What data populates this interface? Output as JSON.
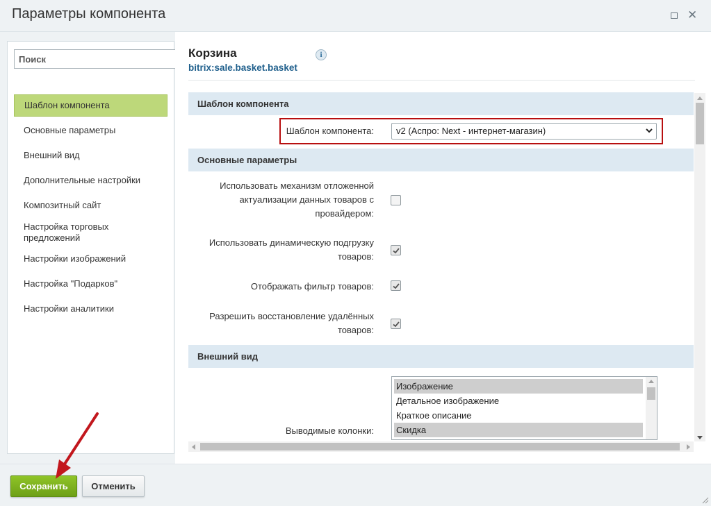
{
  "window": {
    "title": "Параметры компонента"
  },
  "sidebar": {
    "search_placeholder": "Поиск",
    "items": [
      {
        "label": "Шаблон компонента"
      },
      {
        "label": "Основные параметры"
      },
      {
        "label": "Внешний вид"
      },
      {
        "label": "Дополнительные настройки"
      },
      {
        "label": "Композитный сайт"
      },
      {
        "label": "Настройка торговых предложений"
      },
      {
        "label": "Настройки изображений"
      },
      {
        "label": "Настройка \"Подарков\""
      },
      {
        "label": "Настройки аналитики"
      }
    ],
    "active_index": 0
  },
  "component": {
    "name": "Корзина",
    "code": "bitrix:sale.basket.basket",
    "info_glyph": "i"
  },
  "sections": {
    "template": {
      "header": "Шаблон компонента",
      "template_label": "Шаблон компонента:",
      "template_value": "v2 (Аспро: Next - интернет-магазин)"
    },
    "main": {
      "header": "Основные параметры",
      "params": [
        {
          "label_lines": [
            "Использовать механизм отложенной",
            "актуализации данных товаров с",
            "провайдером:"
          ],
          "checked": false
        },
        {
          "label_lines": [
            "Использовать динамическую подгрузку",
            "товаров:"
          ],
          "checked": true
        },
        {
          "label_lines": [
            "Отображать фильтр товаров:"
          ],
          "checked": true
        },
        {
          "label_lines": [
            "Разрешить восстановление удалённых",
            "товаров:"
          ],
          "checked": true
        }
      ]
    },
    "appearance": {
      "header": "Внешний вид",
      "columns_label": "Выводимые колонки:",
      "columns_options": [
        {
          "label": "Изображение",
          "selected": true
        },
        {
          "label": "Детальное изображение",
          "selected": false
        },
        {
          "label": "Краткое описание",
          "selected": false
        },
        {
          "label": "Скидка",
          "selected": true
        }
      ]
    }
  },
  "footer": {
    "save_label": "Сохранить",
    "cancel_label": "Отменить"
  },
  "colors": {
    "accent_green": "#7ab020",
    "active_nav": "#bdd87a",
    "section_bg": "#dde9f2",
    "highlight_red": "#b80f10",
    "link_blue": "#1f5f8c"
  }
}
